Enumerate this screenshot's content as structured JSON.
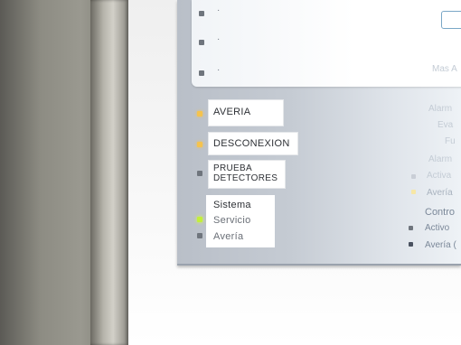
{
  "top_items": [
    "·",
    "·",
    "·"
  ],
  "left_labels": {
    "averia": "AVERIA",
    "desconexion": "DESCONEXION",
    "prueba_line1": "PRUEBA",
    "prueba_line2": "DETECTORES"
  },
  "system_group": {
    "title": "Sistema",
    "servicio": "Servicio",
    "averia": "Avería"
  },
  "right_column_faded": {
    "mas": "Mas A",
    "line1": "Alarm",
    "line2": "Eva",
    "line3": "Fu",
    "line4": "Alarm",
    "line5": "Activa",
    "line6": "Avería",
    "control": "Contro",
    "activo": "Activo",
    "averia": "Avería ("
  },
  "colors": {
    "amber_led": "#f5c34e",
    "green_led": "#c3ef3a",
    "panel_gray": "#c5cbd3"
  }
}
